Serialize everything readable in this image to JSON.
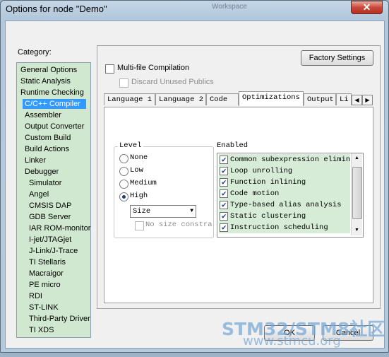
{
  "window": {
    "title": "Options for node \"Demo\"",
    "close_glyph": "✕",
    "background_title": "Workspace"
  },
  "category": {
    "label": "Category:",
    "items": [
      {
        "label": "General Options",
        "indent": false
      },
      {
        "label": "Static Analysis",
        "indent": false
      },
      {
        "label": "Runtime Checking",
        "indent": false
      },
      {
        "label": "C/C++ Compiler",
        "indent": true,
        "selected": true
      },
      {
        "label": "Assembler",
        "indent": true
      },
      {
        "label": "Output Converter",
        "indent": true
      },
      {
        "label": "Custom Build",
        "indent": true
      },
      {
        "label": "Build Actions",
        "indent": true
      },
      {
        "label": "Linker",
        "indent": true
      },
      {
        "label": "Debugger",
        "indent": true
      },
      {
        "label": "Simulator",
        "indent": true,
        "deep": true
      },
      {
        "label": "Angel",
        "indent": true,
        "deep": true
      },
      {
        "label": "CMSIS DAP",
        "indent": true,
        "deep": true
      },
      {
        "label": "GDB Server",
        "indent": true,
        "deep": true
      },
      {
        "label": "IAR ROM-monitor",
        "indent": true,
        "deep": true
      },
      {
        "label": "I-jet/JTAGjet",
        "indent": true,
        "deep": true
      },
      {
        "label": "J-Link/J-Trace",
        "indent": true,
        "deep": true
      },
      {
        "label": "TI Stellaris",
        "indent": true,
        "deep": true
      },
      {
        "label": "Macraigor",
        "indent": true,
        "deep": true
      },
      {
        "label": "PE micro",
        "indent": true,
        "deep": true
      },
      {
        "label": "RDI",
        "indent": true,
        "deep": true
      },
      {
        "label": "ST-LINK",
        "indent": true,
        "deep": true
      },
      {
        "label": "Third-Party Driver",
        "indent": true,
        "deep": true
      },
      {
        "label": "TI XDS",
        "indent": true,
        "deep": true
      }
    ]
  },
  "factory_settings": "Factory Settings",
  "multi_file": {
    "label": "Multi-file Compilation",
    "checked": false
  },
  "discard_publics": {
    "label": "Discard Unused Publics",
    "checked": false,
    "enabled": false
  },
  "tabs": [
    "Language 1",
    "Language 2",
    "Code",
    "Optimizations",
    "Output",
    "Li"
  ],
  "active_tab": "Optimizations",
  "tab_scroll": {
    "left": "◀",
    "right": "▶"
  },
  "level": {
    "title": "Level",
    "options": [
      {
        "label": "None",
        "selected": false
      },
      {
        "label": "Low",
        "selected": false
      },
      {
        "label": "Medium",
        "selected": false
      },
      {
        "label": "High",
        "selected": true
      }
    ],
    "combo_value": "Size",
    "combo_arrow": "▼",
    "no_size": {
      "label": "No size constra",
      "checked": false,
      "enabled": false
    }
  },
  "enabled": {
    "title": "Enabled",
    "items": [
      {
        "label": "Common subexpression elimina",
        "checked": true
      },
      {
        "label": "Loop unrolling",
        "checked": true
      },
      {
        "label": "Function inlining",
        "checked": true
      },
      {
        "label": "Code motion",
        "checked": true
      },
      {
        "label": "Type-based alias analysis",
        "checked": true
      },
      {
        "label": "Static clustering",
        "checked": true
      },
      {
        "label": "Instruction scheduling",
        "checked": true
      }
    ],
    "check_glyph": "✔",
    "scroll_up": "▲",
    "scroll_down": "▼"
  },
  "buttons": {
    "ok": "OK",
    "cancel": "Cancel"
  },
  "watermark": {
    "line1": "STM32/STM8社区",
    "line2": "www.stmcu.org"
  },
  "colors": {
    "list_bg": "#cfe8cf",
    "selection": "#3399ff",
    "close": "#c9493a"
  }
}
